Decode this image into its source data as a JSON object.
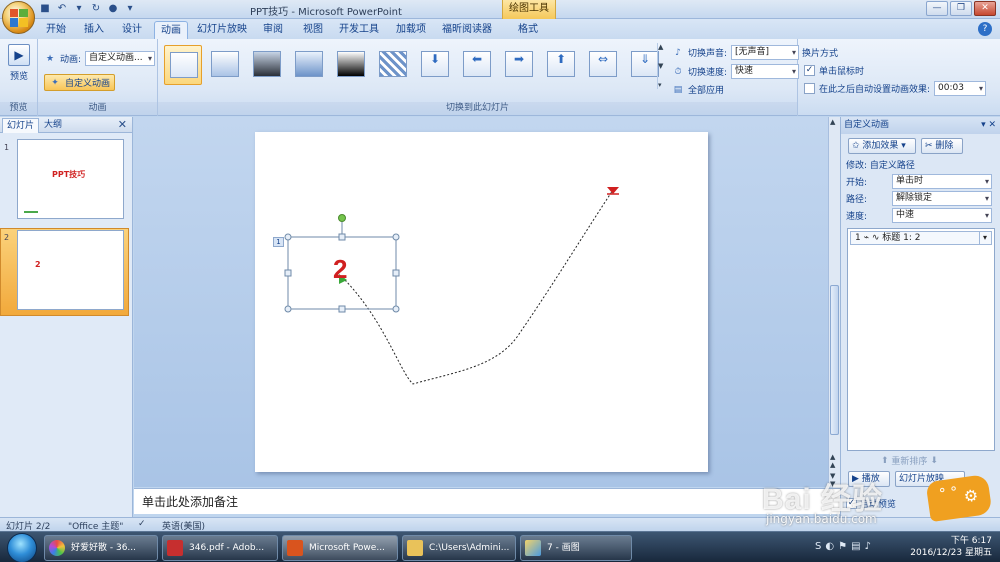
{
  "window": {
    "title": "PPT技巧 - Microsoft PowerPoint",
    "context_tab": "绘图工具"
  },
  "tabs": [
    "开始",
    "插入",
    "设计",
    "动画",
    "幻灯片放映",
    "审阅",
    "视图",
    "开发工具",
    "加载项",
    "福昕阅读器",
    "格式"
  ],
  "active_tab": "动画",
  "ribbon": {
    "preview": {
      "button": "预览",
      "group": "预览"
    },
    "animation": {
      "label": "动画:",
      "value": "自定义动画...",
      "custom_button": "自定义动画",
      "group": "动画"
    },
    "transition": {
      "group": "切换到此幻灯片",
      "sound_label": "切换声音:",
      "sound_value": "[无声音]",
      "speed_label": "切换速度:",
      "speed_value": "快速",
      "apply_all": "全部应用"
    },
    "advance": {
      "title": "换片方式",
      "on_click": "单击鼠标时",
      "after": "在此之后自动设置动画效果:",
      "time": "00:03"
    }
  },
  "left_panel": {
    "tab_slides": "幻灯片",
    "tab_outline": "大纲",
    "slides": [
      {
        "number": "1",
        "title": "PPT技巧"
      },
      {
        "number": "2",
        "title": "2"
      }
    ]
  },
  "slide": {
    "text": "2",
    "anim_tag": "1"
  },
  "notes": "单击此处添加备注",
  "right_pane": {
    "title": "自定义动画",
    "add_effect": "添加效果",
    "remove": "删除",
    "modify": "修改: 自定义路径",
    "start_label": "开始:",
    "start_value": "单击时",
    "path_label": "路径:",
    "path_value": "解除锁定",
    "speed_label": "速度:",
    "speed_value": "中速",
    "list_item": "1 ⌁  ∿  标题 1: 2",
    "reorder": "重新排序",
    "play": "播放",
    "slideshow": "幻灯片放映",
    "autopreview": "自动预览"
  },
  "status": {
    "slide": "幻灯片 2/2",
    "theme": "\"Office 主题\"",
    "lang": "英语(美国)"
  },
  "taskbar": {
    "items": [
      "好爱好散 - 36...",
      "346.pdf - Adob...",
      "Microsoft Powe...",
      "C:\\Users\\Admini...",
      "7 - 画图"
    ],
    "time": "下午 6:17",
    "date": "2016/12/23 星期五"
  },
  "watermark": {
    "brand": "Bai  经验",
    "url": "jingyan.baidu.com"
  }
}
